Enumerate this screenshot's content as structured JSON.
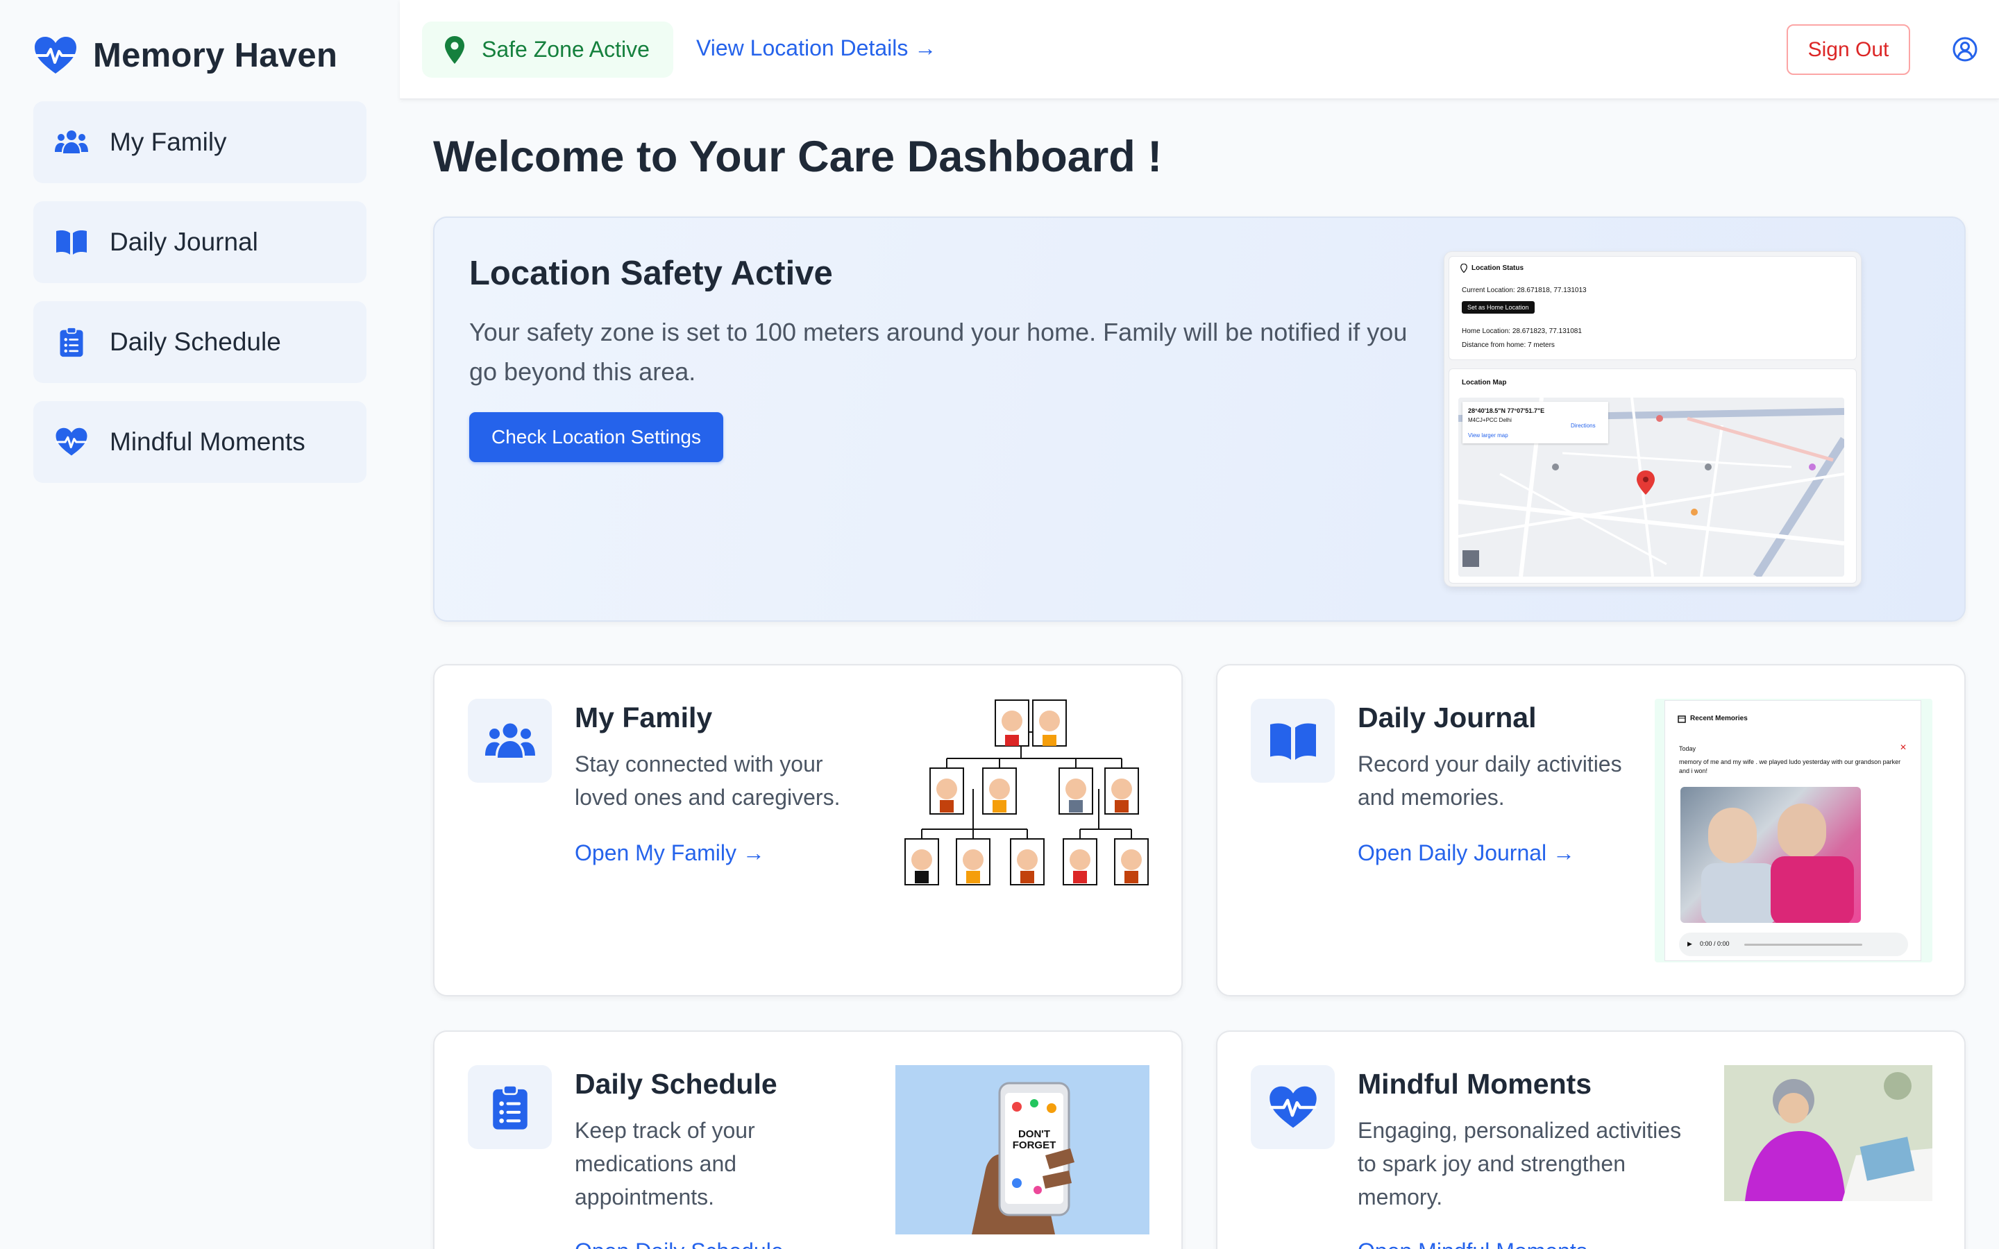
{
  "brand": {
    "name": "Memory Haven",
    "icon": "heart-pulse-icon"
  },
  "sidebar": {
    "items": [
      {
        "label": "My Family",
        "icon": "users-icon"
      },
      {
        "label": "Daily Journal",
        "icon": "book-open-icon"
      },
      {
        "label": "Daily Schedule",
        "icon": "clipboard-list-icon"
      },
      {
        "label": "Mindful Moments",
        "icon": "heart-pulse-icon"
      }
    ]
  },
  "topbar": {
    "status": "Safe Zone Active",
    "location_link": "View Location Details →",
    "sign_out": "Sign Out"
  },
  "main": {
    "welcome": "Welcome to Your Care Dashboard !",
    "hero": {
      "title": "Location Safety Active",
      "text": "Your safety zone is set to 100 meters around your home. Family will be notified if you go beyond this area.",
      "button": "Check Location Settings",
      "preview": {
        "status_title": "Location Status",
        "current": "Current Location: 28.671818, 77.131013",
        "set_home": "Set as Home Location",
        "home": "Home Location: 28.671823, 77.131081",
        "distance": "Distance from home: 7 meters",
        "map_title": "Location Map",
        "coords": "28°40'18.5\"N 77°07'51.7\"E",
        "plus_code": "M4CJ+PCC Delhi",
        "larger_map": "View larger map",
        "directions": "Directions"
      }
    },
    "cards": [
      {
        "title": "My Family",
        "text_lines": [
          "Stay connected with your",
          "loved ones and caregivers."
        ],
        "link": "Open My Family →"
      },
      {
        "title": "Daily Journal",
        "text_lines": [
          "Record your daily activities",
          "and memories."
        ],
        "link": "Open Daily Journal →",
        "preview": {
          "title": "Recent Memories",
          "day": "Today",
          "entry": "memory of me and my wife . we played ludo yesterday with our grandson parker and i won!",
          "audio": "0:00 / 0:00"
        }
      },
      {
        "title": "Daily Schedule",
        "text_lines": [
          "Keep track of your",
          "medications and",
          "appointments."
        ],
        "link": "Open Daily Schedule →",
        "preview": {
          "phone_text": "DON'T FORGET"
        }
      },
      {
        "title": "Mindful Moments",
        "text_lines": [
          "Engaging, personalized activities",
          "to spark joy and strengthen",
          "memory."
        ],
        "link": "Open Mindful Moments →"
      }
    ]
  },
  "colors": {
    "accent": "#2563eb",
    "safe": "#15803d",
    "danger": "#dc2626"
  }
}
